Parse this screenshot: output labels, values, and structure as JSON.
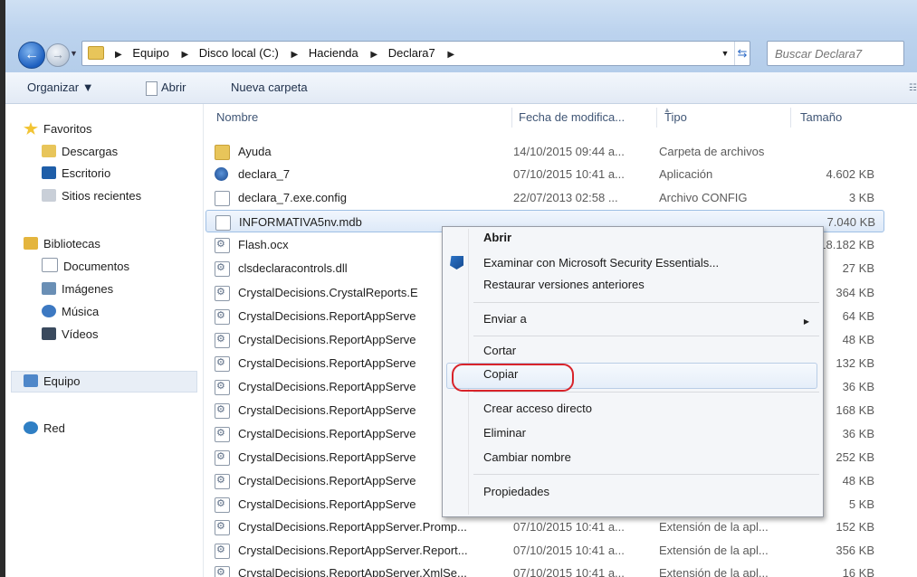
{
  "address": {
    "crumbs": [
      "Equipo",
      "Disco local (C:)",
      "Hacienda",
      "Declara7"
    ],
    "search_placeholder": "Buscar Declara7"
  },
  "toolbar": {
    "organize": "Organizar ▼",
    "open": "Abrir",
    "new_folder": "Nueva carpeta"
  },
  "nav": {
    "favorites": "Favoritos",
    "downloads": "Descargas",
    "desktop": "Escritorio",
    "recent": "Sitios recientes",
    "libraries": "Bibliotecas",
    "documents": "Documentos",
    "images": "Imágenes",
    "music": "Música",
    "videos": "Vídeos",
    "computer": "Equipo",
    "network": "Red"
  },
  "columns": {
    "name": "Nombre",
    "date": "Fecha de modifica...",
    "type": "Tipo",
    "size": "Tamaño"
  },
  "files": [
    {
      "name": "Ayuda",
      "date": "14/10/2015 09:44 a...",
      "type": "Carpeta de archivos",
      "size": "",
      "icon": "folder-icon"
    },
    {
      "name": "declara_7",
      "date": "07/10/2015 10:41 a...",
      "type": "Aplicación",
      "size": "4.602 KB",
      "icon": "app-icon"
    },
    {
      "name": "declara_7.exe.config",
      "date": "22/07/2013 02:58 ...",
      "type": "Archivo CONFIG",
      "size": "3 KB",
      "icon": "document-icon"
    },
    {
      "name": "INFORMATIVA5nv.mdb",
      "date": "",
      "type": "",
      "size": "7.040 KB",
      "icon": "document-icon"
    },
    {
      "name": "Flash.ocx",
      "date": "",
      "type": "",
      "size": "18.182 KB",
      "icon": "dll-icon"
    },
    {
      "name": "clsdeclaracontrols.dll",
      "date": "",
      "type": "",
      "size": "27 KB",
      "icon": "dll-icon"
    },
    {
      "name": "CrystalDecisions.CrystalReports.E",
      "date": "",
      "type": "",
      "size": "364 KB",
      "icon": "dll-icon"
    },
    {
      "name": "CrystalDecisions.ReportAppServe",
      "date": "",
      "type": "",
      "size": "64 KB",
      "icon": "dll-icon"
    },
    {
      "name": "CrystalDecisions.ReportAppServe",
      "date": "",
      "type": "",
      "size": "48 KB",
      "icon": "dll-icon"
    },
    {
      "name": "CrystalDecisions.ReportAppServe",
      "date": "",
      "type": "",
      "size": "132 KB",
      "icon": "dll-icon"
    },
    {
      "name": "CrystalDecisions.ReportAppServe",
      "date": "",
      "type": "",
      "size": "36 KB",
      "icon": "dll-icon"
    },
    {
      "name": "CrystalDecisions.ReportAppServe",
      "date": "",
      "type": "",
      "size": "168 KB",
      "icon": "dll-icon"
    },
    {
      "name": "CrystalDecisions.ReportAppServe",
      "date": "",
      "type": "",
      "size": "36 KB",
      "icon": "dll-icon"
    },
    {
      "name": "CrystalDecisions.ReportAppServe",
      "date": "",
      "type": "",
      "size": "252 KB",
      "icon": "dll-icon"
    },
    {
      "name": "CrystalDecisions.ReportAppServe",
      "date": "",
      "type": "",
      "size": "48 KB",
      "icon": "dll-icon"
    },
    {
      "name": "CrystalDecisions.ReportAppServe",
      "date": "",
      "type": "",
      "size": "5 KB",
      "icon": "dll-icon"
    },
    {
      "name": "CrystalDecisions.ReportAppServer.Promp...",
      "date": "07/10/2015 10:41 a...",
      "type": "Extensión de la apl...",
      "size": "152 KB",
      "icon": "dll-icon"
    },
    {
      "name": "CrystalDecisions.ReportAppServer.Report...",
      "date": "07/10/2015 10:41 a...",
      "type": "Extensión de la apl...",
      "size": "356 KB",
      "icon": "dll-icon"
    },
    {
      "name": "CrystalDecisions.ReportAppServer.XmlSe...",
      "date": "07/10/2015 10:41 a...",
      "type": "Extensión de la apl...",
      "size": "16 KB",
      "icon": "dll-icon"
    }
  ],
  "context_menu": {
    "open": "Abrir",
    "scan": "Examinar con Microsoft Security Essentials...",
    "restore": "Restaurar versiones anteriores",
    "send_to": "Enviar a",
    "cut": "Cortar",
    "copy": "Copiar",
    "shortcut": "Crear acceso directo",
    "delete": "Eliminar",
    "rename": "Cambiar nombre",
    "properties": "Propiedades"
  },
  "colors": {
    "highlight_circle": "#d8232a",
    "selection_border": "#9fbfe4"
  }
}
